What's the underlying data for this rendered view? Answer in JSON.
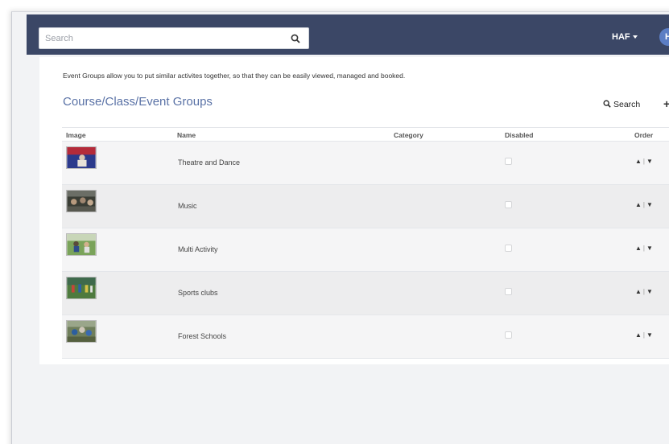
{
  "header": {
    "search_placeholder": "Search",
    "account_label": "HAF",
    "avatar_initial": "H",
    "bar_color": "#3b4766"
  },
  "main": {
    "intro_text": "Event Groups allow you to put similar activites together, so that they can be easily viewed, managed and booked.",
    "title": "Course/Class/Event Groups",
    "search_label": "Search",
    "title_color": "#5a72a6"
  },
  "table": {
    "columns": {
      "image": "Image",
      "name": "Name",
      "category": "Category",
      "disabled": "Disabled",
      "order": "Order"
    },
    "rows": [
      {
        "name": "Theatre and Dance",
        "category": "",
        "disabled": false,
        "thumb": "theatre-dance-thumbnail"
      },
      {
        "name": "Music",
        "category": "",
        "disabled": false,
        "thumb": "music-thumbnail"
      },
      {
        "name": "Multi Activity",
        "category": "",
        "disabled": false,
        "thumb": "multi-activity-thumbnail"
      },
      {
        "name": "Sports clubs",
        "category": "",
        "disabled": false,
        "thumb": "sports-clubs-thumbnail"
      },
      {
        "name": "Forest Schools",
        "category": "",
        "disabled": false,
        "thumb": "forest-schools-thumbnail"
      }
    ],
    "order_up": "▲",
    "order_sep": "|",
    "order_down": "▼"
  }
}
